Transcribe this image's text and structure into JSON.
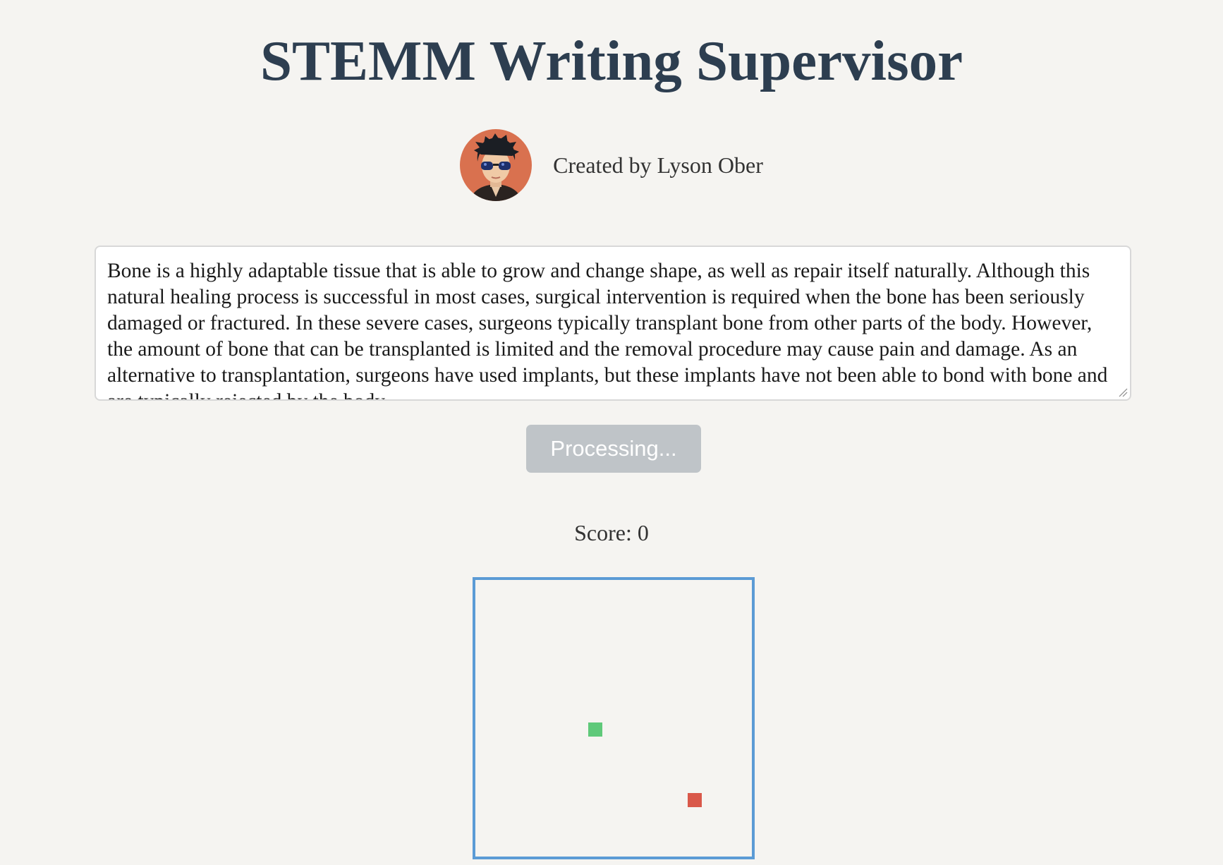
{
  "header": {
    "title": "STEMM Writing Supervisor"
  },
  "author": {
    "label": "Created by Lyson Ober"
  },
  "essay": {
    "value": "Bone is a highly adaptable tissue that is able to grow and change shape, as well as repair itself naturally. Although this natural healing process is successful in most cases, surgical intervention is required when the bone has been seriously damaged or fractured. In these severe cases, surgeons typically transplant bone from other parts of the body. However, the amount of bone that can be transplanted is limited and the removal procedure may cause pain and damage. As an alternative to transplantation, surgeons have used implants, but these implants have not been able to bond with bone and are typically rejected by the body."
  },
  "submit": {
    "label": "Processing..."
  },
  "game": {
    "score_label": "Score: 0",
    "colors": {
      "border": "#5b9bd5",
      "snake": "#5fc97a",
      "food": "#d9584a"
    }
  },
  "colors": {
    "title": "#2d3e50",
    "background": "#f5f4f1",
    "button_disabled": "#bfc4c8"
  }
}
